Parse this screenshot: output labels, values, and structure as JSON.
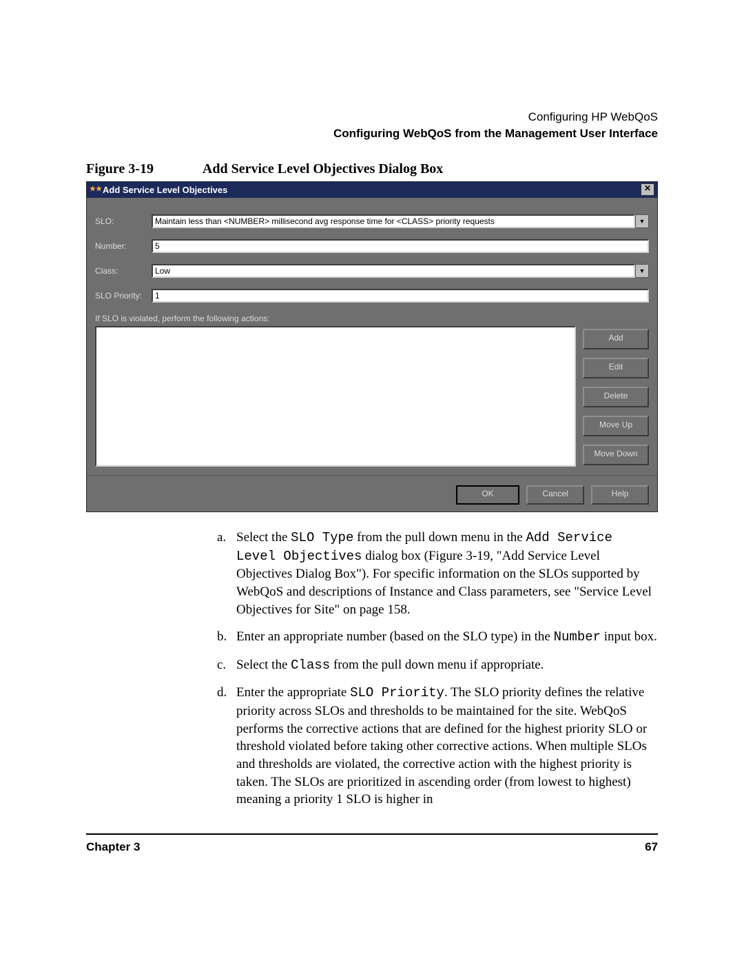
{
  "header": {
    "line1": "Configuring HP WebQoS",
    "line2": "Configuring WebQoS from the Management User Interface"
  },
  "figure": {
    "label": "Figure 3-19",
    "title": "Add Service Level Objectives Dialog Box"
  },
  "dialog": {
    "title": "Add Service Level Objectives",
    "icon": "★★",
    "close": "✕",
    "labels": {
      "slo": "SLO:",
      "number": "Number:",
      "class": "Class:",
      "priority": "SLO Priority:",
      "actions_text": "If SLO is violated, perform the following actions:"
    },
    "values": {
      "slo": "Maintain less than <NUMBER> millisecond avg response time for <CLASS> priority requests",
      "number": "5",
      "class": "Low",
      "priority": "1"
    },
    "dropdown_glyph": "▼",
    "action_buttons": {
      "add": "Add",
      "edit": "Edit",
      "delete": "Delete",
      "move_up": "Move Up",
      "move_down": "Move Down"
    },
    "footer_buttons": {
      "ok": "OK",
      "cancel": "Cancel",
      "help": "Help"
    }
  },
  "instructions": {
    "a": {
      "marker": "a.",
      "p1a": "Select the ",
      "p1b": "SLO Type",
      "p1c": " from the pull down menu in the ",
      "p1d": "Add Service Level Objectives",
      "p1e": " dialog box (Figure 3-19, \"Add Service Level Objectives Dialog Box\"). For specific information on the SLOs supported by WebQoS and descriptions of Instance and Class parameters, see \"Service Level Objectives for Site\" on page 158."
    },
    "b": {
      "marker": "b.",
      "p1a": "Enter an appropriate number (based on the SLO type) in the ",
      "p1b": "Number",
      "p1c": " input box."
    },
    "c": {
      "marker": "c.",
      "p1a": "Select the ",
      "p1b": "Class",
      "p1c": " from the pull down menu if appropriate."
    },
    "d": {
      "marker": "d.",
      "p1a": "Enter the appropriate ",
      "p1b": "SLO Priority",
      "p1c": ". The SLO priority defines the relative priority across SLOs and thresholds to be maintained for the site. WebQoS performs the corrective actions that are defined for the highest priority SLO or threshold violated before taking other corrective actions. When multiple SLOs and thresholds are violated, the corrective action with the highest priority is taken. The SLOs are prioritized in ascending order (from lowest to highest) meaning a priority 1 SLO is higher in"
    }
  },
  "footer": {
    "chapter": "Chapter 3",
    "page_no": "67"
  }
}
